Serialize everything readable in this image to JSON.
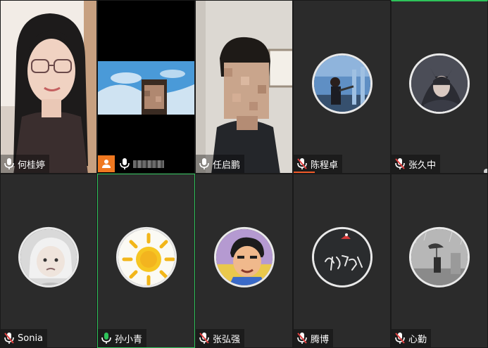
{
  "participants": [
    {
      "name": "何桂婷",
      "type": "video",
      "muted": false
    },
    {
      "name": "",
      "type": "video",
      "muted": false,
      "name_obscured": true
    },
    {
      "name": "任启鹏",
      "type": "video",
      "muted": false
    },
    {
      "name": "陈程卓",
      "type": "avatar",
      "muted": true,
      "avatar_icon": "archery-photo-avatar"
    },
    {
      "name": "张久中",
      "type": "avatar",
      "muted": true,
      "avatar_icon": "warrior-art-avatar"
    },
    {
      "name": "Sonia",
      "type": "avatar",
      "muted": true,
      "avatar_icon": "child-photo-avatar"
    },
    {
      "name": "孙小青",
      "type": "avatar",
      "muted": false,
      "active_speaker": true,
      "avatar_icon": "sun-drawing-avatar"
    },
    {
      "name": "张弘强",
      "type": "avatar",
      "muted": true,
      "avatar_icon": "cartoon-boy-avatar"
    },
    {
      "name": "腾博",
      "type": "avatar",
      "muted": true,
      "avatar_icon": "calligraphy-avatar"
    },
    {
      "name": "心勤",
      "type": "avatar",
      "muted": true,
      "avatar_icon": "rain-walker-photo-avatar"
    }
  ],
  "colors": {
    "tile_bg": "#2b2b2b",
    "active_border": "#2ec35a",
    "muted_mic": "#e04040",
    "host_badge": "#f07820"
  }
}
